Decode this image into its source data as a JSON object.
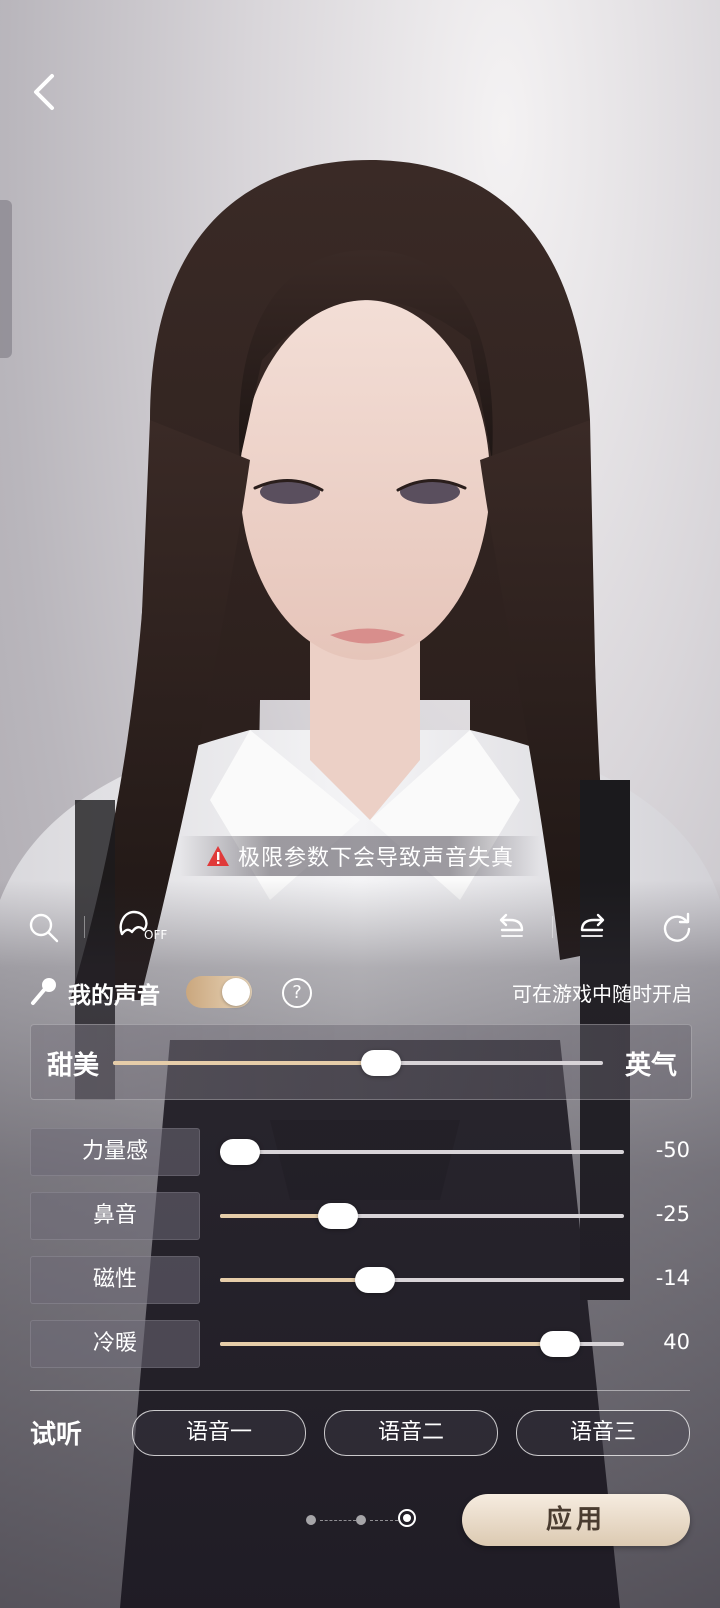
{
  "warning": {
    "text": "极限参数下会导致声音失真"
  },
  "toolbar": {
    "off_badge": "OFF"
  },
  "voice": {
    "title": "我的声音",
    "help": "?",
    "hint": "可在游戏中随时开启",
    "toggle_on": true
  },
  "main_slider": {
    "left_label": "甜美",
    "right_label": "英气",
    "value": 0.55
  },
  "params": [
    {
      "label": "力量感",
      "value": "-50",
      "level": 0.0
    },
    {
      "label": "鼻音",
      "value": "-25",
      "level": 0.27
    },
    {
      "label": "磁性",
      "value": "-14",
      "level": 0.37
    },
    {
      "label": "冷暖",
      "value": "40",
      "level": 0.88
    }
  ],
  "trial": {
    "label": "试听",
    "buttons": [
      "语音一",
      "语音二",
      "语音三"
    ]
  },
  "footer": {
    "apply_label": "应用",
    "page_index": 3,
    "page_count": 3
  },
  "colors": {
    "accent": "#e6cda9",
    "warning": "#e03a3a",
    "apply_text": "#4a3c30"
  }
}
